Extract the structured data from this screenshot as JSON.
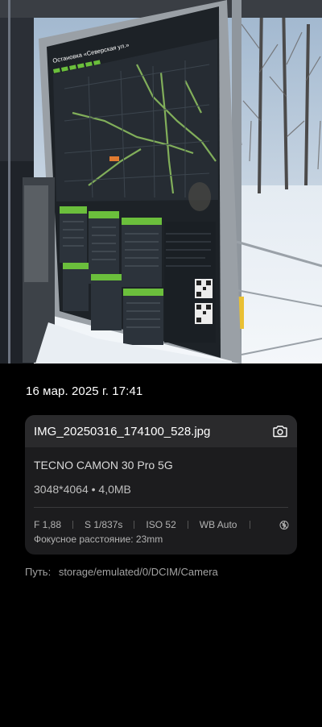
{
  "photo": {
    "sign_title": "Остановка «Северская ул.»",
    "qr_label": "QR"
  },
  "details": {
    "datetime": "16 мар. 2025 г.  17:41",
    "filename": "IMG_20250316_174100_528.jpg",
    "device": "TECNO CAMON 30 Pro 5G",
    "resolution": "3048*4064 • 4,0MB",
    "exif": {
      "aperture": "F 1,88",
      "shutter": "S 1/837s",
      "iso": "ISO 52",
      "white_balance": "WB Auto",
      "flash_icon": "flash-off-icon"
    },
    "focal_length": "Фокусное расстояние: 23mm"
  },
  "path": {
    "label": "Путь:",
    "value": "storage/emulated/0/DCIM/Camera"
  },
  "colors": {
    "background": "#000000",
    "card": "#1c1c1e",
    "card_header": "#2a2a2c",
    "sign_green": "#6bbf3c"
  }
}
